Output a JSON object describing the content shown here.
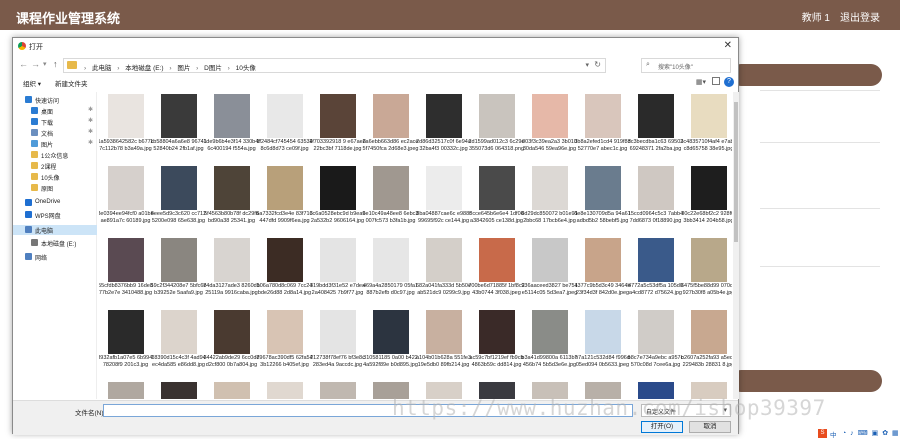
{
  "app": {
    "title": "课程作业管理系统",
    "user": "教师 1",
    "logout": "退出登录"
  },
  "dialog": {
    "title": "打开",
    "close": "✕",
    "breadcrumbs": [
      "此电脑",
      "本地磁盘 (E:)",
      "图片",
      "D图片",
      "10头像"
    ],
    "search_placeholder": "搜索\"10头像\"",
    "toolbar": {
      "organize": "组织 ▾",
      "new_folder": "新建文件夹"
    },
    "nav_items": [
      {
        "label": "快速访问",
        "icon": "star-icon",
        "color": "#2b7cd3"
      },
      {
        "label": "桌面",
        "icon": "desktop-icon",
        "color": "#2b7cd3",
        "pin": true
      },
      {
        "label": "下载",
        "icon": "download-icon",
        "color": "#2b7cd3",
        "pin": true
      },
      {
        "label": "文档",
        "icon": "document-icon",
        "color": "#6b8fbf",
        "pin": true
      },
      {
        "label": "图片",
        "icon": "picture-icon",
        "color": "#4f9bd9",
        "pin": true
      },
      {
        "label": "1公众信息",
        "icon": "folder-icon",
        "color": "#e7b94a"
      },
      {
        "label": "2课程",
        "icon": "folder-icon",
        "color": "#e7b94a"
      },
      {
        "label": "10头像",
        "icon": "folder-icon",
        "color": "#e7b94a"
      },
      {
        "label": "原图",
        "icon": "folder-icon",
        "color": "#e7b94a"
      },
      {
        "label": "OneDrive",
        "icon": "cloud-icon",
        "color": "#1f6fd1"
      },
      {
        "label": "WPS网盘",
        "icon": "cloud-icon",
        "color": "#1f6fd1"
      },
      {
        "label": "此电脑",
        "icon": "computer-icon",
        "color": "#4f7fbf",
        "selected": true
      },
      {
        "label": "本地磁盘 (E:)",
        "icon": "drive-icon",
        "color": "#777777"
      },
      {
        "label": "网络",
        "icon": "network-icon",
        "color": "#4f7fbf"
      }
    ],
    "files": [
      {
        "name": "1a5938642582c b677c7c112b78 b3a49a.jpg",
        "color": "#e9e4e0"
      },
      {
        "name": "1b58804a6a6e8 9674152840b24 2fb1af.jpg",
        "color": "#3a3a3a"
      },
      {
        "name": "1de9b6b4e3f14 330b4f6c400194 f554a.jpg",
        "color": "#8a8f98"
      },
      {
        "name": "1f2484cf745454 635348c6d8d73 ce09f.jpg",
        "color": "#e8e8e8"
      },
      {
        "name": "1f703392918 9 e67ae822bc3bf 7118de.jpg",
        "color": "#5a4438"
      },
      {
        "name": "2a6ebb663d86 ec2ace5f7450fca 2d68e3.jpeg",
        "color": "#c9a896"
      },
      {
        "name": "2d86d32517c0f 6e94a32ba4f3 00332c.jpg",
        "color": "#2e2e2e"
      },
      {
        "name": "2d1599ad012c3 6c29e355073d6 064318.png",
        "color": "#c9c4be"
      },
      {
        "name": "003f3c39ea2a3 3b01030da546 59ea96e.jpg",
        "color": "#e6b8a8"
      },
      {
        "name": "3b8a2efed1cd4 919f8d52770e7 abec1c.jpg",
        "color": "#d9c6bc"
      },
      {
        "name": "3c3becdba1c63 6950269248371 2fa2ba.jpg",
        "color": "#2a2a2a"
      },
      {
        "name": "3c4835710f4af4 e7ab1c8d65758 38e95.jpg",
        "color": "#e8dcc0"
      },
      {
        "name": "3e0394ee94fcf0 a01bbae891a7c 60189.jpg",
        "color": "#d6d0cc"
      },
      {
        "name": "4eee5d9c3c620 cc7125200e098 65e638.jpg",
        "color": "#3c4a5c"
      },
      {
        "name": "5f4563b80b78f dc29fbbd90a38 25341.jpg",
        "color": "#4e4438"
      },
      {
        "name": "6a7332fcd3e4e 83f713447dfd 9909f6ea.jpg",
        "color": "#b8a07a"
      },
      {
        "name": "6c6a0528ebc9d b9ea92a532b2 9606164.jpg",
        "color": "#1a1a1a"
      },
      {
        "name": "6e10c49a48ee8 6ebc3007fc573 b3fa1b.jpg",
        "color": "#a09890"
      },
      {
        "name": "8ba04887cae6c e988f99695f92c ce144.jpg",
        "color": "#ececec"
      },
      {
        "name": "8cce645b6e6e4 1df06a3842605 ce138d.jpg",
        "color": "#4a4a4a"
      },
      {
        "name": "8d29dc850072 b01e912bbc68 17bcb6e4.jpg",
        "color": "#dcd8d4"
      },
      {
        "name": "8e8e130709d5a 94a61adbd5b2 58bebf5.jpg",
        "color": "#6a7c8e"
      },
      {
        "name": "15ccd0964c5c3 7abb47dd6873 0f18890.jpg",
        "color": "#cfc8c2"
      },
      {
        "name": "30c22e68bf2c2 928f0f3bb3414 204b58.jpg",
        "color": "#1e1e1e"
      },
      {
        "name": "55cfdb8376bb9 16de877b2e7e 3410488.jpg",
        "color": "#5a4a52"
      },
      {
        "name": "59c2f344208e7 5bfc6bb39252e 5aafa9.jpg",
        "color": "#8a8680"
      },
      {
        "name": "74da3127ade3 8260db25119a 9916caba.jpg",
        "color": "#d8d4d0"
      },
      {
        "name": "106a780d8c069 7cc24bde26d88 2d8a14.jpg",
        "color": "#3c2c24"
      },
      {
        "name": "319bdd3f31e52 e7dea2a408425 7b9f77.jpg",
        "color": "#e4e4e4"
      },
      {
        "name": "469a4a2850179 05fa1887b2efb d0c97.jpg",
        "color": "#e6e6e6"
      },
      {
        "name": "682a041fa333d 5b50eab521dc9 0299c9.jpg",
        "color": "#d4cfc9"
      },
      {
        "name": "700be6d71885f 1bf8c243b0744 3f038.jpeg",
        "color": "#c86a4a"
      },
      {
        "name": "936aaceed3827 be751e5114c05 5d3ea7.jpeg",
        "color": "#c8c8c8"
      },
      {
        "name": "4377c9b5d3c49 3464b23f34d3f 842d0e.jpeg",
        "color": "#c8a48a"
      },
      {
        "name": "4772a5c53df5a 105d0a4cd8772 d75624.jpg",
        "color": "#3a5a8a"
      },
      {
        "name": "6475f5be88d99 070d4927b30f8 a05b4e.jpg",
        "color": "#b8a88a"
      },
      {
        "name": "8932afb1a07e5 6b994f78208f9 201c3.jpg",
        "color": "#2a2a2a"
      },
      {
        "name": "18390d15c4c3f 4ad94ec4da585 e86dd8.jpg",
        "color": "#dcd4cc"
      },
      {
        "name": "34422ab9de29 6cc0d8d2cf800 0b7a804.jpg",
        "color": "#4a3a30"
      },
      {
        "name": "79678ac390df5 62fa543b12266 b405ef.jpg",
        "color": "#d8c4b4"
      },
      {
        "name": "212738f78ef76 bf3e8c283ed4a 9accdc.jpg",
        "color": "#e4e4e4"
      },
      {
        "name": "310581185 0a00 b4224a592f89e b0d895.jpg",
        "color": "#2c3440"
      },
      {
        "name": "a104b01b628a 551fe319e5db0 89fb214.jpg",
        "color": "#c8b0a0"
      },
      {
        "name": "ac59c7bf1219ef fb9cb4863b59c dd814.jpg",
        "color": "#3a2a28"
      },
      {
        "name": "b3a41d99800a 6113b7456b74 5b5d3e6e.jpg",
        "color": "#8a8c88"
      },
      {
        "name": "b7a121c532d84 f996d05ed094 0b5633.jpeg",
        "color": "#c8d8e8"
      },
      {
        "name": "b8c7e734a9ebc a957c570c08d 7cee6a.jpg",
        "color": "#d0ccc8"
      },
      {
        "name": "b2607a252fa93 a5eda229483b 28831 8.jpg",
        "color": "#c8a890"
      },
      {
        "name": "",
        "color": "#b0a8a0"
      },
      {
        "name": "",
        "color": "#3a3230"
      },
      {
        "name": "",
        "color": "#d0c0b0"
      },
      {
        "name": "",
        "color": "#e0d8d0"
      },
      {
        "name": "",
        "color": "#c0b8b0"
      },
      {
        "name": "",
        "color": "#a8a098"
      },
      {
        "name": "",
        "color": "#d8d0c8"
      },
      {
        "name": "",
        "color": "#3a3a40"
      },
      {
        "name": "",
        "color": "#c8c0b8"
      },
      {
        "name": "",
        "color": "#b8b0a8"
      },
      {
        "name": "",
        "color": "#2a4a8a"
      },
      {
        "name": "",
        "color": "#d8ccc0"
      }
    ],
    "filename_label": "文件名(N):",
    "filename_value": "",
    "file_type": "自定义文件",
    "open_label": "打开(O)",
    "cancel_label": "取消"
  },
  "watermark": "https://www.huzhan.com/ishop39397",
  "tray": {
    "logo": "S",
    "lang": "中",
    "icons": "◔ ♪ ⌨ ▣ ✿ ▦"
  }
}
